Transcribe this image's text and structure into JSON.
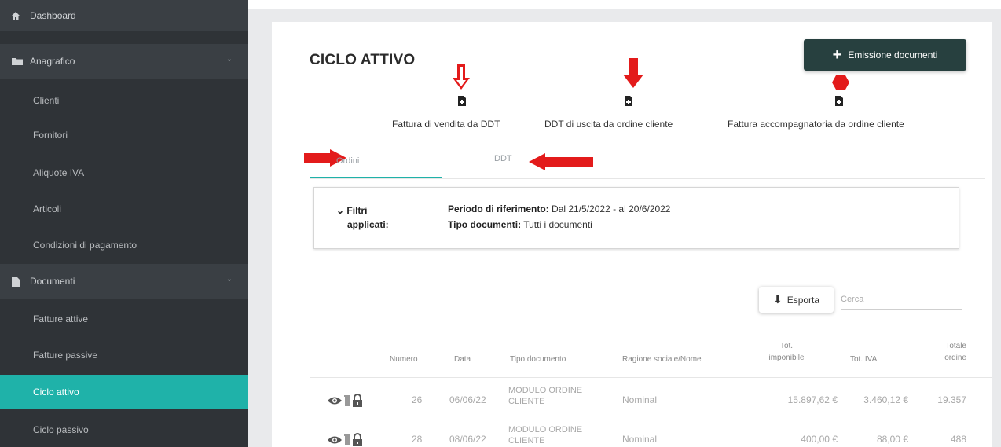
{
  "sidebar": {
    "items": [
      {
        "label": "Dashboard",
        "icon": "home-icon"
      },
      {
        "label": "Anagrafico",
        "icon": "folder-icon"
      },
      {
        "label": "Clienti"
      },
      {
        "label": "Fornitori"
      },
      {
        "label": "Aliquote IVA"
      },
      {
        "label": "Articoli"
      },
      {
        "label": "Condizioni di pagamento"
      },
      {
        "label": "Documenti",
        "icon": "document-icon"
      },
      {
        "label": "Fatture attive"
      },
      {
        "label": "Fatture passive"
      },
      {
        "label": "Ciclo attivo",
        "active": true
      },
      {
        "label": "Ciclo passivo"
      }
    ]
  },
  "header": {
    "title": "CICLO ATTIVO",
    "emit_button": "Emissione documenti"
  },
  "quick_actions": [
    {
      "label": "Fattura di vendita da DDT"
    },
    {
      "label": "DDT di uscita da ordine cliente"
    },
    {
      "label": "Fattura accompagnatoria da ordine cliente"
    }
  ],
  "tabs": [
    {
      "label": "Ordini",
      "active": true
    },
    {
      "label": "DDT"
    }
  ],
  "filters": {
    "toggle": "Filtri",
    "toggle2": "applicati:",
    "period_label": "Periodo di riferimento:",
    "period_value": "Dal 21/5/2022 - al 20/6/2022",
    "type_label": "Tipo documenti:",
    "type_value": "Tutti i documenti"
  },
  "toolbar": {
    "export_label": "Esporta",
    "search_placeholder": "Cerca"
  },
  "table": {
    "headers": {
      "numero": "Numero",
      "data": "Data",
      "tipo": "Tipo documento",
      "ragione": "Ragione sociale/Nome",
      "imponibile1": "Tot.",
      "imponibile2": "imponibile",
      "iva": "Tot. IVA",
      "totale1": "Totale",
      "totale2": "ordine"
    },
    "rows": [
      {
        "numero": "26",
        "data": "06/06/22",
        "tipo1": "MODULO ORDINE",
        "tipo2": "CLIENTE",
        "ragione": "Nominal",
        "imponibile": "15.897,62 €",
        "iva": "3.460,12 €",
        "totale": "19.357"
      },
      {
        "numero": "28",
        "data": "08/06/22",
        "tipo1": "MODULO ORDINE",
        "tipo2": "CLIENTE",
        "ragione": "Nominal",
        "imponibile": "400,00 €",
        "iva": "88,00 €",
        "totale": "488"
      }
    ]
  },
  "colors": {
    "sidebar_bg": "#2f3337",
    "accent": "#1fb2a9",
    "button_dark": "#27403f",
    "annotation_red": "#e31b1b"
  }
}
